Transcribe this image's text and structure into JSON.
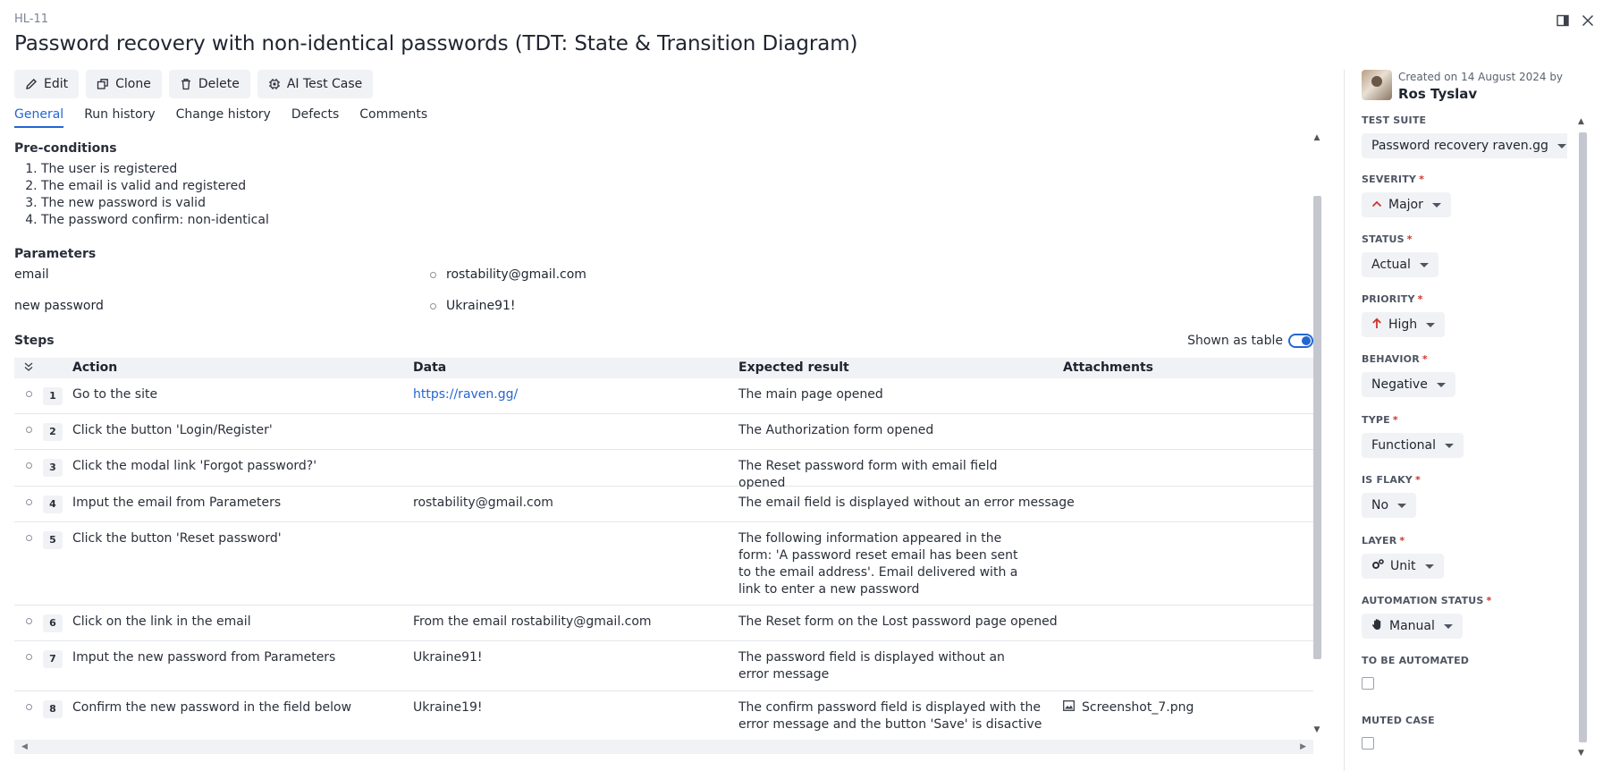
{
  "header": {
    "case_id": "HL-11",
    "title": "Password recovery with non-identical passwords (TDT: State & Transition Diagram)"
  },
  "toolbar": {
    "edit": "Edit",
    "clone": "Clone",
    "delete": "Delete",
    "ai": "AI Test Case"
  },
  "tabs": [
    "General",
    "Run history",
    "Change history",
    "Defects",
    "Comments"
  ],
  "preconditions": {
    "title": "Pre-conditions",
    "items": [
      "The user is registered",
      "The email is valid and registered",
      "The new password is valid",
      "The password confirm: non-identical"
    ]
  },
  "parameters": {
    "title": "Parameters",
    "items": [
      {
        "name": "email",
        "value": "rostability@gmail.com"
      },
      {
        "name": "new password",
        "value": "Ukraine91!"
      }
    ]
  },
  "steps": {
    "title": "Steps",
    "shown_as_table": "Shown as table",
    "columns": [
      "Action",
      "Data",
      "Expected result",
      "Attachments"
    ],
    "rows": [
      {
        "num": "1",
        "action": "Go to the site",
        "data": "https://raven.gg/",
        "expected": "The main page opened",
        "attachment": ""
      },
      {
        "num": "2",
        "action": "Click the button 'Login/Register'",
        "data": "",
        "expected": "The Authorization form opened",
        "attachment": ""
      },
      {
        "num": "3",
        "action": "Click the modal link 'Forgot password?'",
        "data": "",
        "expected": "The Reset password form with email field opened",
        "attachment": ""
      },
      {
        "num": "4",
        "action": "Imput the email from Parameters",
        "data": "rostability@gmail.com",
        "expected": "The email field is displayed without an error message",
        "attachment": ""
      },
      {
        "num": "5",
        "action": "Click the button 'Reset password'",
        "data": "",
        "expected": "The following information appeared in the form: 'A password reset email has been sent to the email address'. Email delivered with a link to enter a new password",
        "attachment": ""
      },
      {
        "num": "6",
        "action": "Click on the link in the email",
        "data": "From the email rostability@gmail.com",
        "expected": "The Reset form on the Lost password page opened",
        "attachment": ""
      },
      {
        "num": "7",
        "action": "Imput the new password from Parameters",
        "data": "Ukraine91!",
        "expected": "The password field is displayed without an error message",
        "attachment": ""
      },
      {
        "num": "8",
        "action": "Confirm the new password in the field below",
        "data": "Ukraine19!",
        "expected": "The confirm password field is displayed with the error message and the button 'Save' is disactive",
        "attachment": "Screenshot_7.png"
      }
    ]
  },
  "sidebar": {
    "created": "Created on 14 August 2024 by",
    "author": "Ros Tyslav",
    "fields": {
      "test_suite": {
        "label": "TEST SUITE",
        "value": "Password recovery raven.gg"
      },
      "severity": {
        "label": "SEVERITY",
        "value": "Major"
      },
      "status": {
        "label": "STATUS",
        "value": "Actual"
      },
      "priority": {
        "label": "PRIORITY",
        "value": "High"
      },
      "behavior": {
        "label": "BEHAVIOR",
        "value": "Negative"
      },
      "type": {
        "label": "TYPE",
        "value": "Functional"
      },
      "is_flaky": {
        "label": "IS FLAKY",
        "value": "No"
      },
      "layer": {
        "label": "LAYER",
        "value": "Unit"
      },
      "automation_status": {
        "label": "AUTOMATION STATUS",
        "value": "Manual"
      },
      "to_be_automated": {
        "label": "TO BE AUTOMATED"
      },
      "muted_case": {
        "label": "MUTED CASE"
      }
    },
    "required_mark": "*"
  },
  "colors": {
    "accent": "#2466d0",
    "required": "#d0342c",
    "severity_icon": "#d0342c",
    "priority_icon": "#d0342c"
  },
  "icons": {
    "edit": "pencil-icon",
    "clone": "copy-icon",
    "delete": "trash-icon",
    "ai": "chip-icon",
    "panel": "panel-toggle-icon",
    "close": "close-icon",
    "collapse_all": "collapse-icon",
    "attachment": "image-icon",
    "severity": "chevron-up-icon",
    "priority": "arrow-up-icon",
    "layer": "gears-icon",
    "automation": "hand-icon"
  }
}
